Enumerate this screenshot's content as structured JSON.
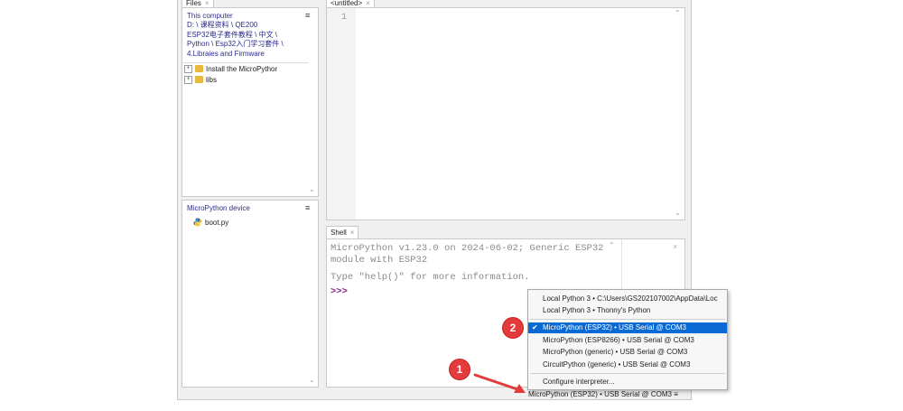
{
  "files_tab": {
    "label": "Files",
    "close": "×"
  },
  "editor_tab": {
    "label": "<untitled>",
    "close": "×"
  },
  "shell_tab": {
    "label": "Shell",
    "close": "×"
  },
  "files_panel": {
    "heading": "This computer",
    "path_lines": [
      "D: \\ 课程资料 \\ QE200",
      "ESP32电子套件教程 \\ 中文 \\",
      "Python \\ Esp32入门学习套件 \\",
      "4.Libraies and Firmware"
    ],
    "menu_icon": "≡",
    "items": [
      {
        "toggle": "+",
        "icon": "folder-icon",
        "label": "Install the MicroPythor"
      },
      {
        "toggle": "+",
        "icon": "folder-icon",
        "label": "libs"
      }
    ]
  },
  "device_panel": {
    "heading": "MicroPython device",
    "menu_icon": "≡",
    "items": [
      {
        "icon": "python-file-icon",
        "label": "boot.py"
      }
    ]
  },
  "editor": {
    "line_numbers": [
      "1"
    ]
  },
  "shell": {
    "lines": [
      "MicroPython v1.23.0 on 2024-06-02; Generic ESP32",
      "module with ESP32"
    ],
    "help_line": "Type \"help()\" for more information.",
    "prompt": ">>>",
    "close": "×"
  },
  "interpreter_menu": {
    "items": [
      {
        "label": "Local Python 3  •  C:\\Users\\GS202107002\\AppData\\Loc",
        "checked": false
      },
      {
        "label": "Local Python 3  •  Thonny's Python",
        "checked": false
      },
      {
        "label": "MicroPython (ESP32)  •  USB Serial @ COM3",
        "checked": true
      },
      {
        "label": "MicroPython (ESP8266)  •  USB Serial @ COM3",
        "checked": false
      },
      {
        "label": "MicroPython (generic)  •  USB Serial @ COM3",
        "checked": false
      },
      {
        "label": "CircuitPython (generic)  •  USB Serial @ COM3",
        "checked": false
      },
      {
        "label": "Configure interpreter...",
        "checked": false
      }
    ],
    "check_mark": "✔"
  },
  "status_bar": {
    "interpreter": "MicroPython (ESP32)  •  USB Serial @ COM3  ≡"
  },
  "annotations": {
    "step1": "1",
    "step2": "2",
    "badge_color": "#e33b3b",
    "arrow_color": "#e33b3b"
  },
  "colors": {
    "selection": "#0a6ad5",
    "link": "#2b2b8e"
  }
}
